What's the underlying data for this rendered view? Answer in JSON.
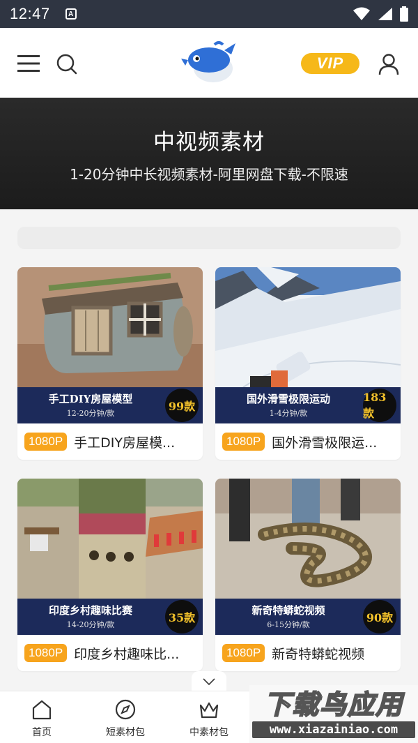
{
  "status_bar": {
    "time": "12:47",
    "notif_icon": "a-icon"
  },
  "header": {
    "vip_label": "VIP",
    "logo_icon": "fish-logo"
  },
  "banner": {
    "title": "中视频素材",
    "subtitle": "1-20分钟中长视频素材-阿里网盘下载-不限速"
  },
  "cards": [
    {
      "thumb_title": "手工DIY房屋模型",
      "thumb_sub": "12-20分钟/款",
      "count": "99款",
      "resolution": "1080P",
      "title": "手工DIY房屋模..."
    },
    {
      "thumb_title": "国外滑雪极限运动",
      "thumb_sub": "1-4分钟/款",
      "count": "183款",
      "resolution": "1080P",
      "title": "国外滑雪极限运..."
    },
    {
      "thumb_title": "印度乡村趣味比赛",
      "thumb_sub": "14-20分钟/款",
      "count": "35款",
      "resolution": "1080P",
      "title": "印度乡村趣味比..."
    },
    {
      "thumb_title": "新奇特蟒蛇视频",
      "thumb_sub": "6-15分钟/款",
      "count": "90款",
      "resolution": "1080P",
      "title": "新奇特蟒蛇视频"
    }
  ],
  "bottom_nav": [
    {
      "label": "首页",
      "icon": "home-icon"
    },
    {
      "label": "短素材包",
      "icon": "compass-icon"
    },
    {
      "label": "中素材包",
      "icon": "crown-icon"
    }
  ],
  "watermark": {
    "main": "下载鸟应用",
    "url": "www.xiazainiao.com"
  },
  "colors": {
    "status_bar": "#2f3542",
    "vip": "#f6b819",
    "badge": "#f7a41d",
    "thumb_bar": "#1c2a5a",
    "count_text": "#f3c22b"
  }
}
